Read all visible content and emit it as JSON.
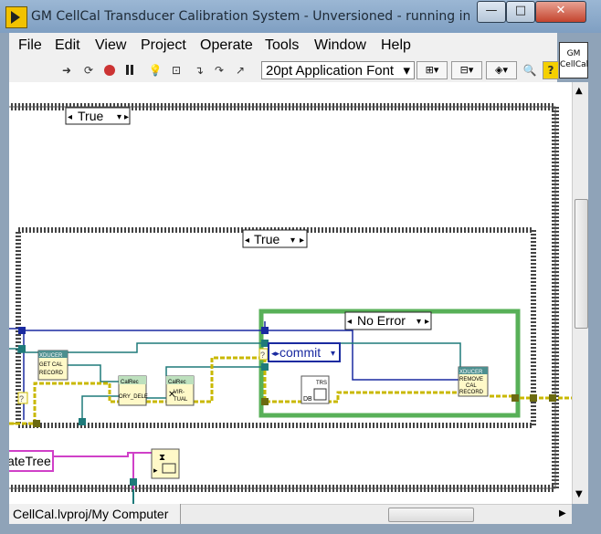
{
  "window": {
    "title": "GM CellCal  Transducer Calibration System  - Unversioned - running in d...",
    "minimize": "—",
    "maximize": "□",
    "close": "✕"
  },
  "menu": [
    "File",
    "Edit",
    "View",
    "Project",
    "Operate",
    "Tools",
    "Window",
    "Help"
  ],
  "toolbar": {
    "font_select": "20pt Application Font",
    "icons": [
      "run-arrow-icon",
      "run-continuous-icon",
      "abort-icon",
      "pause-icon",
      "highlight-execution-icon",
      "retain-wire-values-icon",
      "step-into-icon",
      "step-over-icon",
      "step-out-icon",
      "align-objects-icon",
      "distribute-objects-icon",
      "reorder-icon",
      "search-icon",
      "help-icon"
    ]
  },
  "vi_icon": {
    "line1": "GM",
    "line2": "CellCal"
  },
  "diagram": {
    "outer_case": "True",
    "inner_case": "True",
    "error_case": "No Error",
    "commit_enum": "commit",
    "nodes": {
      "getcal": [
        "XDUCER",
        "GET CAL",
        "RECORD"
      ],
      "calrec1": [
        "CalRec",
        "ORY_DELE"
      ],
      "calrec2": [
        "CalRec",
        "VIR-",
        "TUAL"
      ],
      "trs": [
        "TRS",
        "DB"
      ],
      "remove": [
        "XDUCER",
        "REMOVE",
        "CAL",
        "RECORD"
      ]
    },
    "tree_label": "ateTree"
  },
  "status": {
    "path": "CellCal.lvproj/My Computer"
  },
  "colors": {
    "wire_error": "#c9b800",
    "wire_ref": "#1e7a7a",
    "wire_blue": "#1a2aa0",
    "wire_pink": "#d040c8",
    "case_border": "#333333",
    "green_frame": "#58b058"
  }
}
